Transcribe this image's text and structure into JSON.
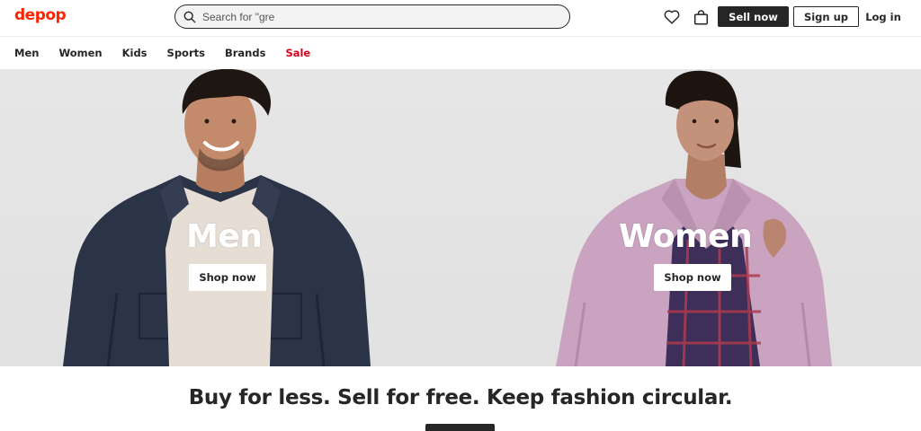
{
  "header": {
    "logo": "depop",
    "search": {
      "placeholder": "Search for \"gre",
      "icon": "search-icon"
    },
    "icons": [
      "heart-icon",
      "shopping-bag-icon"
    ],
    "sell_label": "Sell now",
    "signup_label": "Sign up",
    "login_label": "Log in"
  },
  "nav": {
    "items": [
      {
        "label": "Men"
      },
      {
        "label": "Women"
      },
      {
        "label": "Kids"
      },
      {
        "label": "Sports"
      },
      {
        "label": "Brands"
      },
      {
        "label": "Sale",
        "color": "#d6001c"
      }
    ]
  },
  "hero": {
    "left": {
      "title": "Men",
      "button": "Shop now"
    },
    "right": {
      "title": "Women",
      "button": "Shop now"
    }
  },
  "tagline": "Buy for less. Sell for free. Keep fashion circular.",
  "colors": {
    "brand": "#ff2300",
    "dark": "#262626",
    "sale": "#d6001c"
  }
}
